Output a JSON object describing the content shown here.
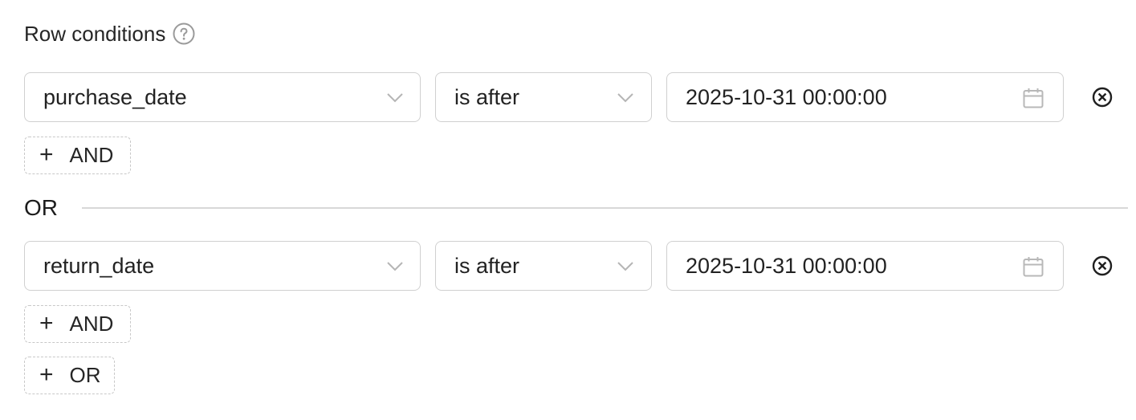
{
  "section": {
    "title": "Row conditions"
  },
  "groups": [
    {
      "conditions": [
        {
          "field": "purchase_date",
          "operator": "is after",
          "value": "2025-10-31 00:00:00"
        }
      ],
      "add_and_label": "AND"
    },
    {
      "conditions": [
        {
          "field": "return_date",
          "operator": "is after",
          "value": "2025-10-31 00:00:00"
        }
      ],
      "add_and_label": "AND"
    }
  ],
  "separator_label": "OR",
  "add_or_label": "OR",
  "icons": {
    "help": "question-circle-icon",
    "dropdown": "chevron-down-icon",
    "date": "calendar-icon",
    "remove": "close-circle-icon",
    "add": "plus-icon"
  }
}
